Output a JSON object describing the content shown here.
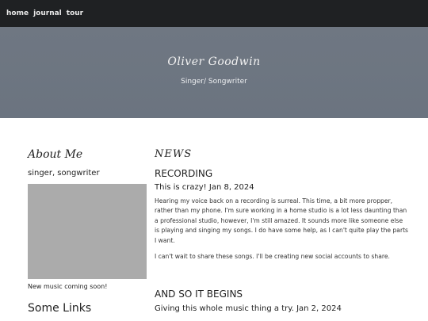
{
  "nav": {
    "items": [
      "home",
      "journal",
      "tour"
    ]
  },
  "hero": {
    "name": "Oliver Goodwin",
    "tagline": "Singer/ Songwriter"
  },
  "sidebar": {
    "heading": "About Me",
    "role": "singer, songwriter",
    "photo_caption": "New music coming soon!",
    "links_heading": "Some Links"
  },
  "news": {
    "heading": "NEWS",
    "posts": [
      {
        "title": "RECORDING",
        "subtitle": "This is crazy! Jan 8, 2024",
        "paragraphs": [
          "Hearing my voice back on a recording is surreal. This time, a bit more propper, rather than my phone. I'm sure working in a home studio is a lot less daunting than a professional studio, however, I'm still amazed. It sounds more like someone else is playing and singing my songs. I do have some help, as I can't quite play the parts I want.",
          "I can't wait to share these songs. I'll be creating new social accounts to share."
        ]
      },
      {
        "title": "AND SO IT BEGINS",
        "subtitle": "Giving this whole music thing a try. Jan 2, 2024"
      }
    ]
  },
  "colors": {
    "nav_bg": "#1f2123",
    "hero_bg": "#6f7782",
    "photo_placeholder": "#ababab"
  }
}
